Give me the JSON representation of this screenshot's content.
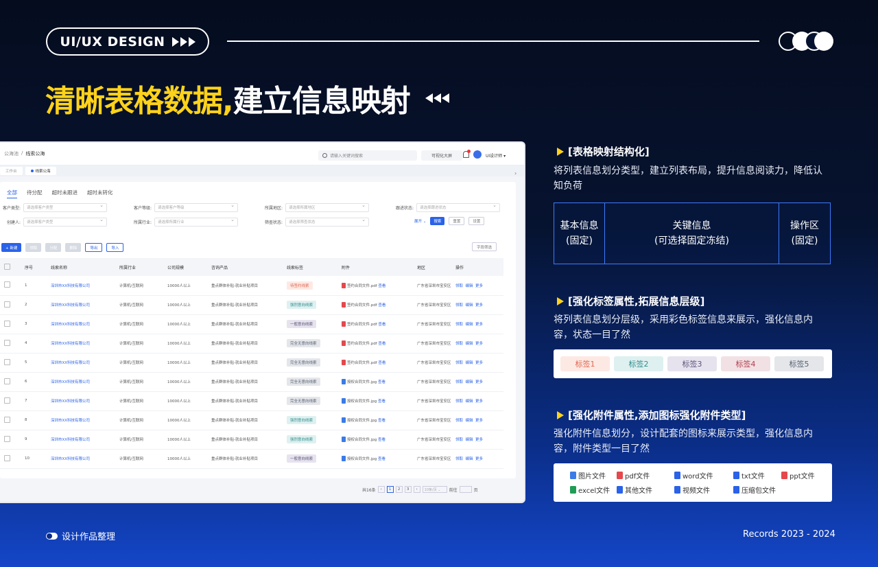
{
  "header": {
    "pill_label": "UI/UX DESIGN",
    "headline_yellow": "清晰表格数据,",
    "headline_white": "建立信息映射"
  },
  "app": {
    "breadcrumb": [
      "公海池",
      "/",
      "线索公海"
    ],
    "search_placeholder": "请输入关键词搜索",
    "bigscreen_label": "可视化大屏",
    "user_name": "UI设计师 ▾",
    "open_tabs": [
      "工作台",
      "线索公海"
    ],
    "sub_tabs": [
      "全部",
      "待分配",
      "超时未跟进",
      "超时未转化"
    ],
    "filters": [
      {
        "label": "客户类型:",
        "placeholder": "请选择客户类型"
      },
      {
        "label": "客户等级:",
        "placeholder": "请选择客户等级"
      },
      {
        "label": "所属地区:",
        "placeholder": "请选择所属地区"
      },
      {
        "label": "跟进状态:",
        "placeholder": "请选择跟进状态"
      },
      {
        "label": "创建人:",
        "placeholder": "请选择客户类型"
      },
      {
        "label": "所属行业:",
        "placeholder": "请选择所属行业"
      },
      {
        "label": "筛查状态:",
        "placeholder": "请选择筛查状态"
      }
    ],
    "filter_buttons": {
      "expand": "展开 ⌄",
      "search": "搜索",
      "reset": "重置",
      "settings": "设置"
    },
    "toolbar": {
      "new": "+ 新建",
      "edit": "领取",
      "assign": "分配",
      "delete": "删除",
      "export": "导出",
      "import": "导入",
      "col_filter": "字段筛选"
    },
    "columns": [
      "",
      "序号",
      "线索名称",
      "所属行业",
      "公司规模",
      "咨询产品",
      "线索标签",
      "附件",
      "地区",
      "操作"
    ],
    "rows": [
      {
        "no": "1",
        "name": "深圳市XX科技有限公司",
        "industry": "计算机/互联网",
        "scale": "10000人以上",
        "product": "重点群体补贴-就业补贴项目",
        "tag": "待签约线索",
        "tag_style": "t1",
        "file": "签约合同文件.pdf",
        "file_type": "pdf",
        "view": "查看",
        "region": "广东省深圳市宝安区",
        "ops": [
          "领取",
          "编辑",
          "更多"
        ]
      },
      {
        "no": "2",
        "name": "深圳市XX科技有限公司",
        "industry": "计算机/互联网",
        "scale": "10000人以上",
        "product": "重点群体补贴-就业补贴项目",
        "tag": "强烈意向线索",
        "tag_style": "t2",
        "file": "签约合同文件.pdf",
        "file_type": "pdf",
        "view": "查看",
        "region": "广东省深圳市宝安区",
        "ops": [
          "领取",
          "编辑",
          "更多"
        ]
      },
      {
        "no": "3",
        "name": "深圳市XX科技有限公司",
        "industry": "计算机/互联网",
        "scale": "10000人以上",
        "product": "重点群体补贴-就业补贴项目",
        "tag": "一般意向线索",
        "tag_style": "t3",
        "file": "签约合同文件.pdf",
        "file_type": "pdf",
        "view": "查看",
        "region": "广东省深圳市宝安区",
        "ops": [
          "领取",
          "编辑",
          "更多"
        ]
      },
      {
        "no": "4",
        "name": "深圳市XX科技有限公司",
        "industry": "计算机/互联网",
        "scale": "10000人以上",
        "product": "重点群体补贴-就业补贴项目",
        "tag": "完全无意向线索",
        "tag_style": "t5",
        "file": "签约合同文件.pdf",
        "file_type": "pdf",
        "view": "查看",
        "region": "广东省深圳市宝安区",
        "ops": [
          "领取",
          "编辑",
          "更多"
        ]
      },
      {
        "no": "5",
        "name": "深圳市XX科技有限公司",
        "industry": "计算机/互联网",
        "scale": "10000人以上",
        "product": "重点群体补贴-就业补贴项目",
        "tag": "完全无意向线索",
        "tag_style": "t5",
        "file": "签约合同文件.pdf",
        "file_type": "pdf",
        "view": "查看",
        "region": "广东省深圳市宝安区",
        "ops": [
          "领取",
          "编辑",
          "更多"
        ]
      },
      {
        "no": "6",
        "name": "深圳市XX科技有限公司",
        "industry": "计算机/互联网",
        "scale": "10000人以上",
        "product": "重点群体补贴-就业补贴项目",
        "tag": "完全无意向线索",
        "tag_style": "t5",
        "file": "授权合同文件.jpg",
        "file_type": "jpg",
        "view": "查看",
        "region": "广东省深圳市宝安区",
        "ops": [
          "领取",
          "编辑",
          "更多"
        ]
      },
      {
        "no": "7",
        "name": "深圳市XX科技有限公司",
        "industry": "计算机/互联网",
        "scale": "10000人以上",
        "product": "重点群体补贴-就业补贴项目",
        "tag": "完全无意向线索",
        "tag_style": "t5",
        "file": "授权合同文件.jpg",
        "file_type": "jpg",
        "view": "查看",
        "region": "广东省深圳市宝安区",
        "ops": [
          "领取",
          "编辑",
          "更多"
        ]
      },
      {
        "no": "8",
        "name": "深圳市XX科技有限公司",
        "industry": "计算机/互联网",
        "scale": "10000人以上",
        "product": "重点群体补贴-就业补贴项目",
        "tag": "强烈意向线索",
        "tag_style": "t2",
        "file": "授权合同文件.jpg",
        "file_type": "jpg",
        "view": "查看",
        "region": "广东省深圳市宝安区",
        "ops": [
          "领取",
          "编辑",
          "更多"
        ]
      },
      {
        "no": "9",
        "name": "深圳市XX科技有限公司",
        "industry": "计算机/互联网",
        "scale": "10000人以上",
        "product": "重点群体补贴-就业补贴项目",
        "tag": "强烈意向线索",
        "tag_style": "t2",
        "file": "授权合同文件.jpg",
        "file_type": "jpg",
        "view": "查看",
        "region": "广东省深圳市宝安区",
        "ops": [
          "领取",
          "编辑",
          "更多"
        ]
      },
      {
        "no": "10",
        "name": "深圳市XX科技有限公司",
        "industry": "计算机/互联网",
        "scale": "10000人以上",
        "product": "重点群体补贴-就业补贴项目",
        "tag": "一般意向线索",
        "tag_style": "t3",
        "file": "授权合同文件.jpg",
        "file_type": "jpg",
        "view": "查看",
        "region": "广东省深圳市宝安区",
        "ops": [
          "领取",
          "编辑",
          "更多"
        ]
      }
    ],
    "pager": {
      "total": "共16条",
      "pages": [
        "1",
        "2",
        "3"
      ],
      "page_size": "10条/页 ⌄",
      "jump_label": "前往",
      "page_unit": "页"
    }
  },
  "sections": [
    {
      "title": "[表格映射结构化]",
      "desc": "将列表信息划分类型，建立列表布局，提升信息阅读力，降低认知负荷"
    },
    {
      "title": "[强化标签属性,拓展信息层级]",
      "desc": "将列表信息划分层级，采用彩色标签信息来展示，强化信息内容，状态一目了然"
    },
    {
      "title": "[强化附件属性,添加图标强化附件类型]",
      "desc": "强化附件信息划分，设计配套的图标来展示类型，强化信息内容，附件类型一目了然"
    }
  ],
  "mapping": [
    {
      "line1": "基本信息",
      "line2": "(固定)"
    },
    {
      "line1": "关键信息",
      "line2": "(可选择固定冻结)"
    },
    {
      "line1": "操作区",
      "line2": "(固定)"
    }
  ],
  "tags": [
    {
      "label": "标签1",
      "bg": "#fde9e4",
      "color": "#e0664f"
    },
    {
      "label": "标签2",
      "bg": "#dff0f0",
      "color": "#2f8c8c"
    },
    {
      "label": "标签3",
      "bg": "#e6e3ee",
      "color": "#5c5478"
    },
    {
      "label": "标签4",
      "bg": "#f2e1e4",
      "color": "#b0404f"
    },
    {
      "label": "标签5",
      "bg": "#e4e6ea",
      "color": "#556070"
    }
  ],
  "file_types": [
    {
      "label": "图片文件",
      "icon": "image-file-icon",
      "color": "#3b7be8"
    },
    {
      "label": "pdf文件",
      "icon": "pdf-file-icon",
      "color": "#e5484d"
    },
    {
      "label": "word文件",
      "icon": "word-file-icon",
      "color": "#2a62e8"
    },
    {
      "label": "txt文件",
      "icon": "txt-file-icon",
      "color": "#2a62e8"
    },
    {
      "label": "ppt文件",
      "icon": "ppt-file-icon",
      "color": "#e5484d"
    },
    {
      "label": "excel文件",
      "icon": "excel-file-icon",
      "color": "#1f9d55"
    },
    {
      "label": "其他文件",
      "icon": "other-file-icon",
      "color": "#2a62e8"
    },
    {
      "label": "视频文件",
      "icon": "video-file-icon",
      "color": "#2a62e8"
    },
    {
      "label": "压缩包文件",
      "icon": "zip-file-icon",
      "color": "#2a62e8"
    }
  ],
  "footer": {
    "left": "设计作品整理",
    "right": "Records  2023 - 2024"
  },
  "colors": {
    "accent_yellow": "#ffd21a",
    "accent_blue": "#3d7bff",
    "primary": "#2a62e8"
  }
}
